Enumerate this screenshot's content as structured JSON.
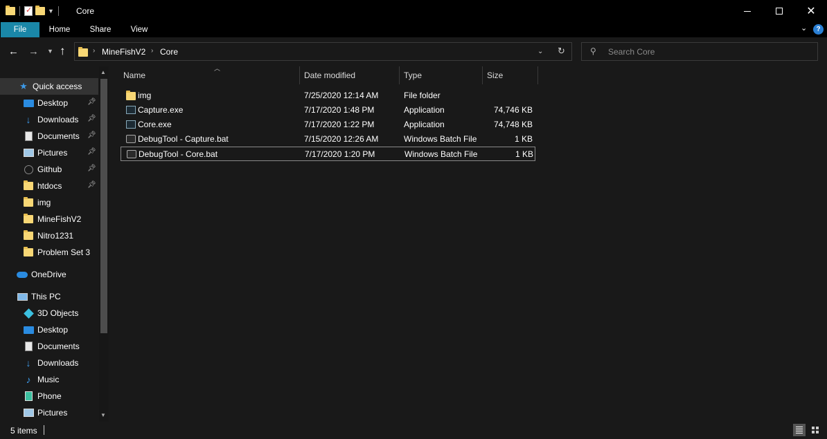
{
  "window": {
    "title": "Core"
  },
  "ribbon": {
    "tabs": [
      "File",
      "Home",
      "Share",
      "View"
    ],
    "accent": "#1a87a8"
  },
  "address": {
    "crumbs": [
      "MineFishV2",
      "Core"
    ]
  },
  "search": {
    "placeholder": "Search Core"
  },
  "nav_pane": {
    "quick_access": {
      "label": "Quick access",
      "items": [
        {
          "label": "Desktop",
          "icon": "desktop-icon",
          "pinned": true
        },
        {
          "label": "Downloads",
          "icon": "downloads-icon",
          "pinned": true
        },
        {
          "label": "Documents",
          "icon": "documents-icon",
          "pinned": true
        },
        {
          "label": "Pictures",
          "icon": "pictures-icon",
          "pinned": true
        },
        {
          "label": "Github",
          "icon": "github-icon",
          "pinned": true
        },
        {
          "label": "htdocs",
          "icon": "folder-icon",
          "pinned": true
        },
        {
          "label": "img",
          "icon": "folder-icon",
          "pinned": false
        },
        {
          "label": "MineFishV2",
          "icon": "folder-icon",
          "pinned": false
        },
        {
          "label": "Nitro1231",
          "icon": "folder-icon",
          "pinned": false
        },
        {
          "label": "Problem Set 3",
          "icon": "folder-icon",
          "pinned": false
        }
      ]
    },
    "onedrive": {
      "label": "OneDrive"
    },
    "this_pc": {
      "label": "This PC",
      "items": [
        {
          "label": "3D Objects",
          "icon": "3d-objects-icon"
        },
        {
          "label": "Desktop",
          "icon": "desktop-icon"
        },
        {
          "label": "Documents",
          "icon": "documents-icon"
        },
        {
          "label": "Downloads",
          "icon": "downloads-icon"
        },
        {
          "label": "Music",
          "icon": "music-icon"
        },
        {
          "label": "Phone",
          "icon": "phone-icon"
        },
        {
          "label": "Pictures",
          "icon": "pictures-icon"
        }
      ]
    }
  },
  "file_list": {
    "columns": [
      "Name",
      "Date modified",
      "Type",
      "Size"
    ],
    "rows": [
      {
        "name": "img",
        "date": "7/25/2020 12:14 AM",
        "type": "File folder",
        "size": "",
        "icon": "folder-icon"
      },
      {
        "name": "Capture.exe",
        "date": "7/17/2020 1:48 PM",
        "type": "Application",
        "size": "74,746 KB",
        "icon": "exe-icon"
      },
      {
        "name": "Core.exe",
        "date": "7/17/2020 1:22 PM",
        "type": "Application",
        "size": "74,748 KB",
        "icon": "exe-icon"
      },
      {
        "name": "DebugTool - Capture.bat",
        "date": "7/15/2020 12:26 AM",
        "type": "Windows Batch File",
        "size": "1 KB",
        "icon": "batch-file-icon"
      },
      {
        "name": "DebugTool - Core.bat",
        "date": "7/17/2020 1:20 PM",
        "type": "Windows Batch File",
        "size": "1 KB",
        "icon": "batch-file-icon"
      }
    ]
  },
  "status": {
    "items_text": "5 items"
  }
}
